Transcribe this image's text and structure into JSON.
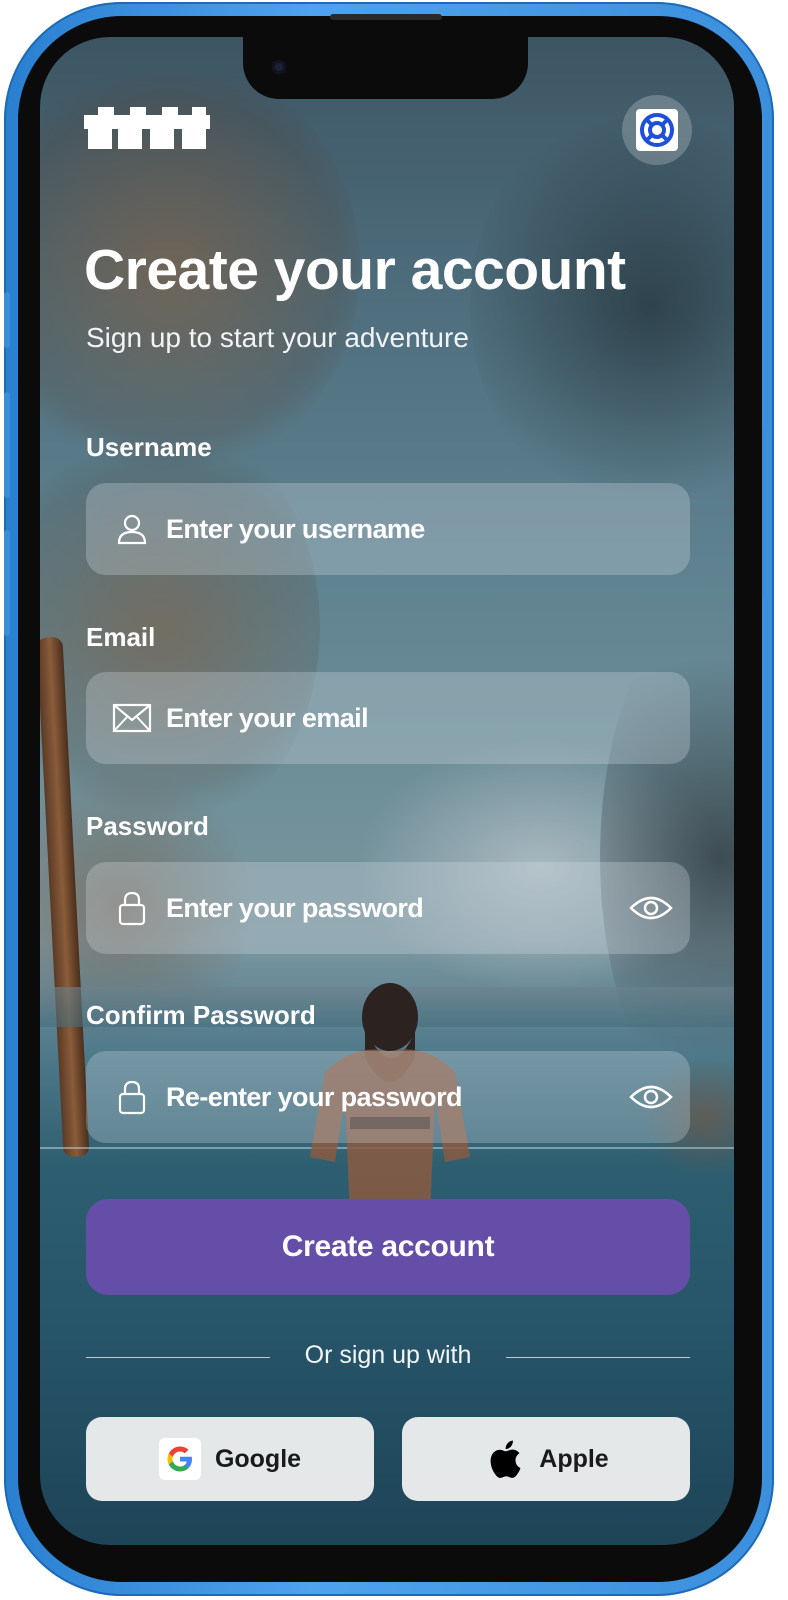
{
  "header": {
    "logo_icon": "brand-logo",
    "help_icon": "lifebuoy-icon"
  },
  "page": {
    "title": "Create your account",
    "subtitle": "Sign up to start your adventure"
  },
  "form": {
    "username": {
      "label": "Username",
      "placeholder": "Enter your username",
      "icon": "user-icon"
    },
    "email": {
      "label": "Email",
      "placeholder": "Enter your email",
      "icon": "mail-icon"
    },
    "password": {
      "label": "Password",
      "placeholder": "Enter your password",
      "icon": "lock-icon",
      "toggle_icon": "eye-icon"
    },
    "confirm_password": {
      "label": "Confirm Password",
      "placeholder": "Re-enter your password",
      "icon": "lock-icon",
      "toggle_icon": "eye-icon"
    }
  },
  "actions": {
    "submit_label": "Create account",
    "divider_text": "Or sign up with",
    "google_label": "Google",
    "apple_label": "Apple"
  },
  "colors": {
    "primary": "#654ea7",
    "device_frame": "#3b8fdc"
  }
}
